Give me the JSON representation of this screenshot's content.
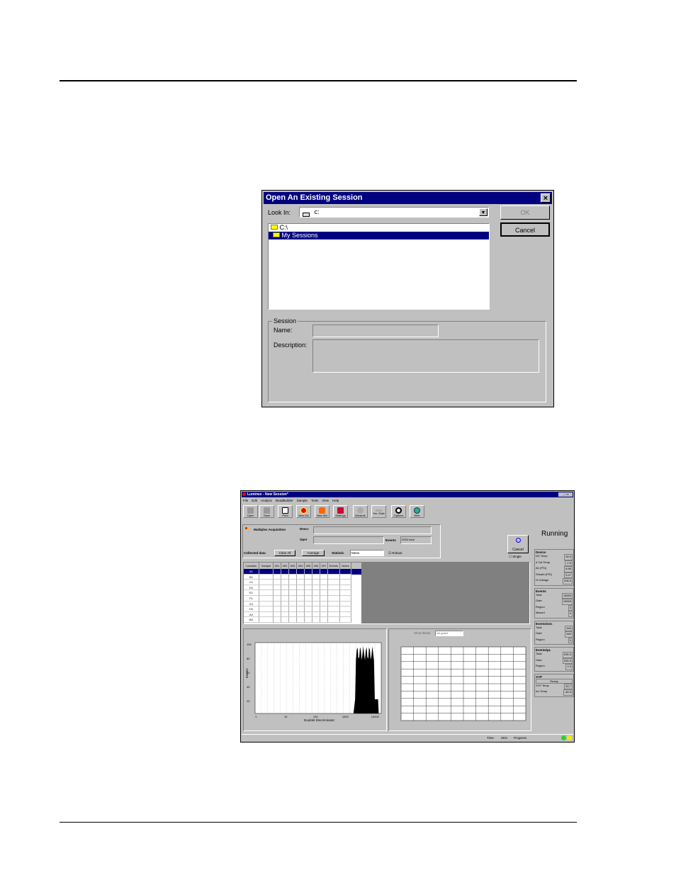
{
  "dialog": {
    "title": "Open An Existing Session",
    "close": "×",
    "look_in_label": "Look In:",
    "look_in_value": "c:",
    "ok_label": "OK",
    "cancel_label": "Cancel",
    "tree_items": [
      "C:\\",
      "My Sessions"
    ],
    "session_group": "Session",
    "name_label": "Name:",
    "description_label": "Description:"
  },
  "app": {
    "title": "Luminex - New Session*",
    "menu": [
      "File",
      "Edit",
      "Analyze",
      "BeadBuilder",
      "Sample",
      "Tools",
      "View",
      "Help"
    ],
    "toolbar": [
      "Open",
      "Save",
      "Print",
      "New DA",
      "New MA",
      "Settings",
      "Wizards",
      "Ver. Gate",
      "Options",
      "Web"
    ],
    "acq_title": "Multiplex Acquisition",
    "descr_label": "Descr",
    "oper_label": "Oper",
    "events_label": "Events",
    "events_value": "2000 total",
    "collected_label": "Collected data",
    "clear_all": "Clear All",
    "average": "Average",
    "statistic_label": "Statistic",
    "statistic_value": "Mean",
    "robust_label": "Robust",
    "cancel_button": "Cancel",
    "single_label": "Single",
    "status": "Running",
    "table_headers": [
      "Location",
      "Sample",
      "001",
      "002",
      "003",
      "004",
      "005",
      "006",
      "007",
      "Events",
      "Notes"
    ],
    "rows": [
      "A1",
      "B1",
      "C1",
      "D1",
      "E1",
      "F1",
      "G1",
      "H1",
      "A2",
      "B2"
    ],
    "device": {
      "title": "Device",
      "items": [
        [
          "DD Temp",
          "28.0"
        ],
        [
          "d Cal Temp",
          "-2.6"
        ],
        [
          "Air (PSI)",
          "8.86"
        ],
        [
          "Sheath (PSI)",
          "5.47"
        ],
        [
          "Hi Voltage",
          "206.5"
        ]
      ]
    },
    "events": {
      "title": "Events",
      "items": [
        [
          "Total",
          "15559"
        ],
        [
          "Gate",
          "15559"
        ],
        [
          "Region",
          "0"
        ],
        [
          "Missed",
          "0"
        ]
      ]
    },
    "events_sec": {
      "title": "Events/sec",
      "items": [
        [
          "Total",
          "540"
        ],
        [
          "Gate",
          "540"
        ],
        [
          "Region",
          "0"
        ]
      ]
    },
    "events_ul": {
      "title": "Events/µL",
      "items": [
        [
          "Total",
          "535.9"
        ],
        [
          "Gate",
          "535.9"
        ],
        [
          "Region",
          "0.3"
        ]
      ]
    },
    "xyp": {
      "title": "XYP",
      "status": "Ready",
      "items": [
        [
          "XYP Temp",
          "33.7"
        ],
        [
          "Inc Temp",
          "-45.9"
        ]
      ]
    },
    "hist_ylabel": "Events",
    "hist_xlabel": "Doublet Discriminator",
    "hist_xticks": [
      "1",
      "10",
      "100",
      "1000",
      "10000"
    ],
    "hist_yticks": [
      "100",
      "80",
      "60",
      "40",
      "20"
    ],
    "show_beads_label": "Show Bead",
    "show_beads_value": "all gated",
    "statusbar_time_label": "Time",
    "statusbar_time": "29:5",
    "statusbar_progress": "Progress"
  },
  "colors": {
    "titlebar": "#000080",
    "face": "#c0c0c0",
    "selection": "#000080"
  }
}
